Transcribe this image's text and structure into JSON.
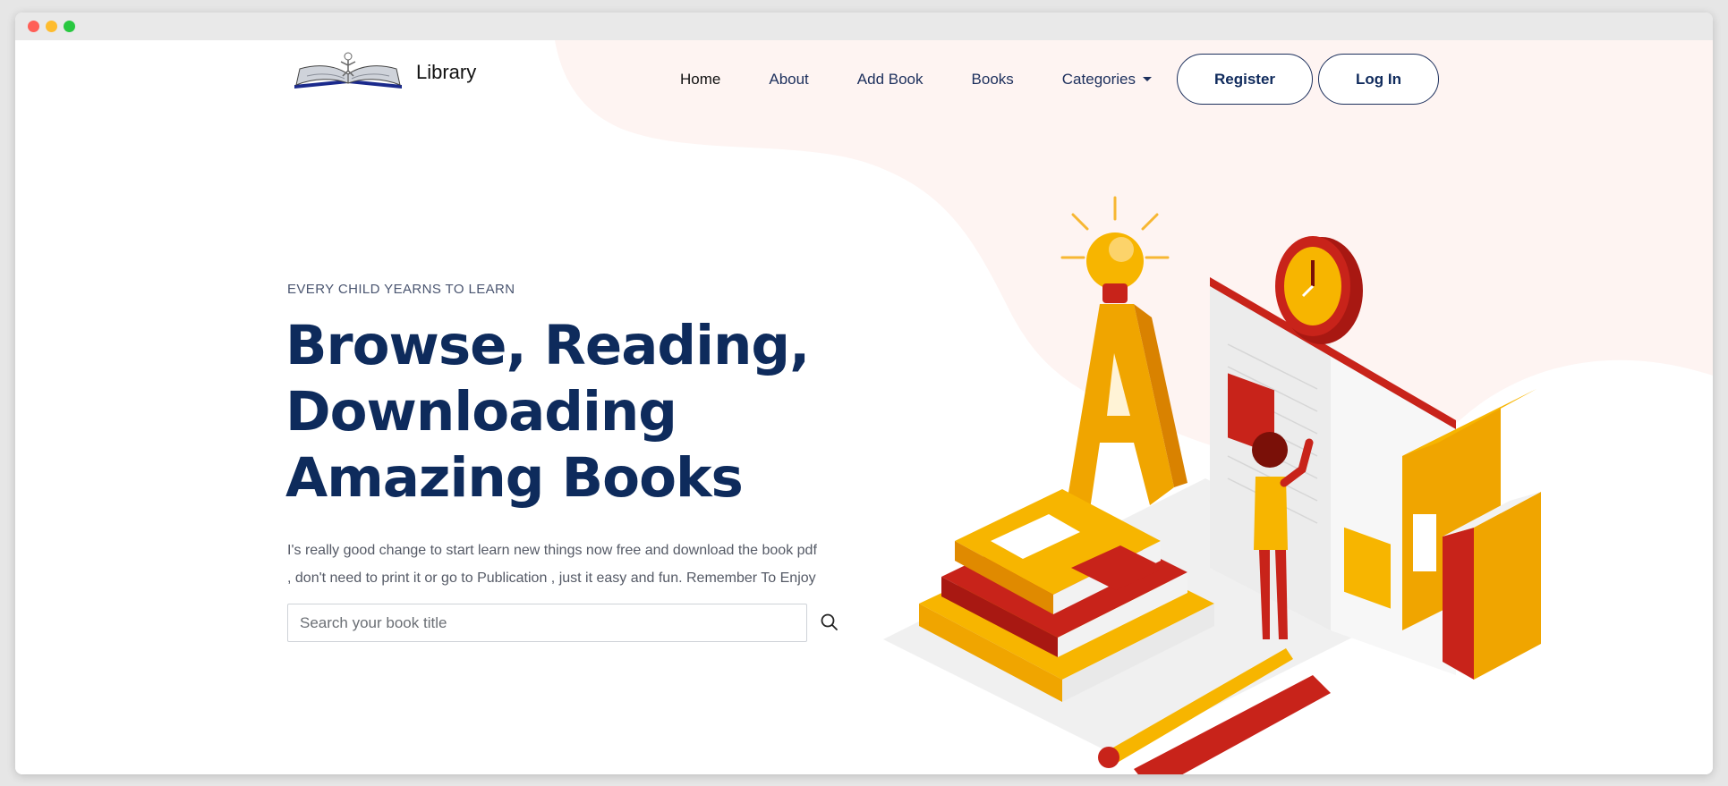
{
  "window": {
    "controls": [
      "close",
      "minimize",
      "maximize"
    ]
  },
  "brand": {
    "name": "Library",
    "logo_icon": "open-book-icon"
  },
  "nav": {
    "home": "Home",
    "about": "About",
    "add_book": "Add Book",
    "books": "Books",
    "categories": "Categories"
  },
  "buttons": {
    "register": "Register",
    "login": "Log In"
  },
  "hero": {
    "eyebrow": "EVERY CHILD YEARNS TO LEARN",
    "headline_line1": "Browse, Reading,",
    "headline_line2": "Downloading",
    "headline_line3": "Amazing Books",
    "description_line1": "I's really good change to start learn new things now free and download the book pdf",
    "description_line2": ", don't need to print it or go to Publication , just it easy and fun. Remember To Enjoy"
  },
  "search": {
    "placeholder": "Search your book title",
    "value": "",
    "icon": "search-icon"
  },
  "colors": {
    "primary_navy": "#0e2b5c",
    "accent_orange": "#f5a300",
    "accent_red": "#c8231a",
    "blob_pink": "#fef4f2"
  }
}
